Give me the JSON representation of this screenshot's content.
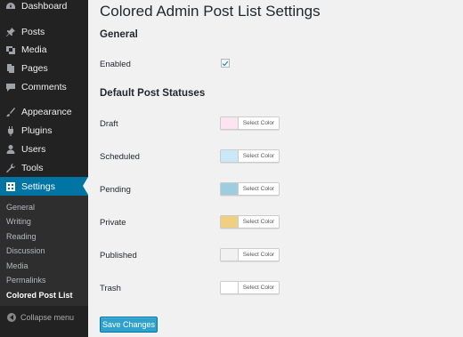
{
  "sidebar": {
    "items": [
      {
        "label": "Dashboard",
        "icon": "dashboard-icon"
      },
      {
        "label": "Posts",
        "icon": "pin-icon"
      },
      {
        "label": "Media",
        "icon": "media-icon"
      },
      {
        "label": "Pages",
        "icon": "pages-icon"
      },
      {
        "label": "Comments",
        "icon": "comment-icon"
      },
      {
        "label": "Appearance",
        "icon": "brush-icon"
      },
      {
        "label": "Plugins",
        "icon": "plug-icon"
      },
      {
        "label": "Users",
        "icon": "user-icon"
      },
      {
        "label": "Tools",
        "icon": "wrench-icon"
      },
      {
        "label": "Settings",
        "icon": "settings-icon"
      }
    ],
    "submenu": [
      {
        "label": "General"
      },
      {
        "label": "Writing"
      },
      {
        "label": "Reading"
      },
      {
        "label": "Discussion"
      },
      {
        "label": "Media"
      },
      {
        "label": "Permalinks"
      },
      {
        "label": "Colored Post List"
      }
    ],
    "collapse_label": "Collapse menu"
  },
  "main": {
    "title": "Colored Admin Post List Settings",
    "general_title": "General",
    "enabled_label": "Enabled",
    "enabled_checked": true,
    "statuses_title": "Default Post Statuses",
    "statuses": [
      {
        "label": "Draft",
        "color": "#fce4f0",
        "button": "Select Color"
      },
      {
        "label": "Scheduled",
        "color": "#c9e8f8",
        "button": "Select Color"
      },
      {
        "label": "Pending",
        "color": "#9ecde0",
        "button": "Select Color"
      },
      {
        "label": "Private",
        "color": "#f0d080",
        "button": "Select Color"
      },
      {
        "label": "Published",
        "color": "#f1f1f1",
        "button": "Select Color"
      },
      {
        "label": "Trash",
        "color": "#ffffff",
        "button": "Select Color"
      }
    ],
    "save_label": "Save Changes"
  },
  "colors": {
    "sidebar_bg": "#222222",
    "submenu_bg": "#2e2e2e",
    "accent": "#0074a2",
    "button_bg": "#2ea2cc",
    "page_bg": "#f1f1f1"
  }
}
